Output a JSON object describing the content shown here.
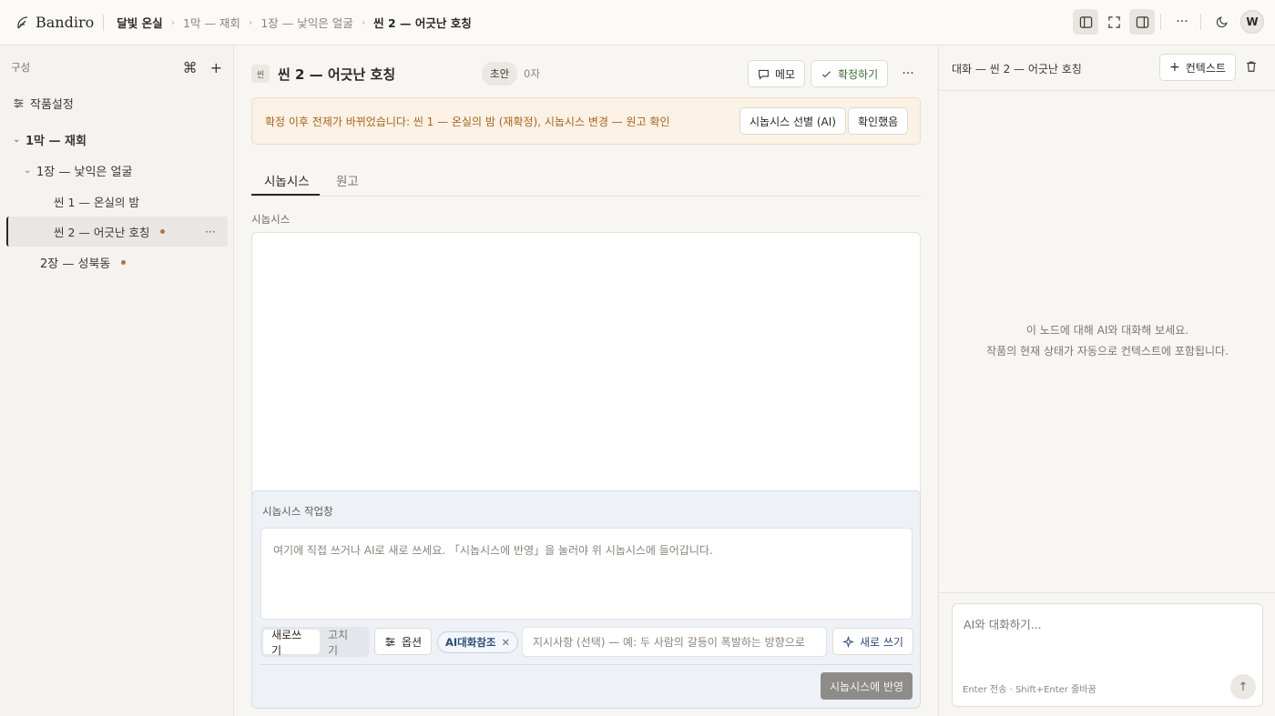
{
  "app": {
    "brand": "Bandiro"
  },
  "breadcrumb": {
    "items": [
      "달빛 온실",
      "1막 — 재회",
      "1장 — 낯익은 얼굴",
      "씬 2 — 어긋난 호칭"
    ]
  },
  "user": {
    "avatar_initial": "W"
  },
  "sidebar": {
    "header_label": "구성",
    "settings_label": "작품설정",
    "tree": [
      {
        "label": "1막 — 재회",
        "expanded": true
      },
      {
        "label": "1장 — 낯익은 얼굴",
        "expanded": true
      },
      {
        "label": "씬 1 — 온실의 밤"
      },
      {
        "label": "씬 2 — 어긋난 호칭",
        "selected": true,
        "changed": true
      },
      {
        "label": "2장 — 성북동",
        "changed": true
      }
    ]
  },
  "scene": {
    "chip": "씬",
    "title": "씬 2 — 어긋난 호칭",
    "status": "초안",
    "char_count": "0자",
    "memo_label": "메모",
    "confirm_label": "확정하기"
  },
  "banner": {
    "text": "확정 이후 전제가 바뀌었습니다: 씬 1 — 온실의 밤 (재확정), 시놉시스 변경 — 원고 확인",
    "action_review": "시놉시스 선별 (AI)",
    "action_ack": "확인했음"
  },
  "tabs": [
    {
      "label": "시놉시스",
      "active": true
    },
    {
      "label": "원고"
    }
  ],
  "synopsis": {
    "label": "시놉시스"
  },
  "workbench": {
    "title": "시놉시스 작업창",
    "placeholder": "여기에 직접 쓰거나 AI로 새로 쓰세요. 「시놉시스에 반영」을 눌러야 위 시놉시스에 들어갑니다.",
    "mode_new": "새로쓰기",
    "mode_edit": "고치기",
    "options_label": "옵션",
    "chip_label": "AI대화참조",
    "instruction_placeholder": "지시사항 (선택) — 예: 두 사람의 갈등이 폭발하는 방향으로",
    "rewrite_label": "새로 쓰기",
    "apply_label": "시놉시스에 반영"
  },
  "chat": {
    "title": "대화 — 씬 2 — 어긋난 호칭",
    "context_label": "컨텍스트",
    "empty_line1": "이 노드에 대해 AI와 대화해 보세요.",
    "empty_line2": "작품의 현재 상태가 자동으로 컨텍스트에 포함됩니다.",
    "input_placeholder": "AI와 대화하기...",
    "hint": "Enter 전송 · Shift+Enter 줄바꿈"
  },
  "colors": {
    "accent_warning_bg": "#fbf1e5",
    "accent_warning_text": "#a8651f",
    "change_dot": "#b4773f",
    "workbench_bg": "#eef2f7",
    "confirm_green": "#3f6a3a"
  }
}
